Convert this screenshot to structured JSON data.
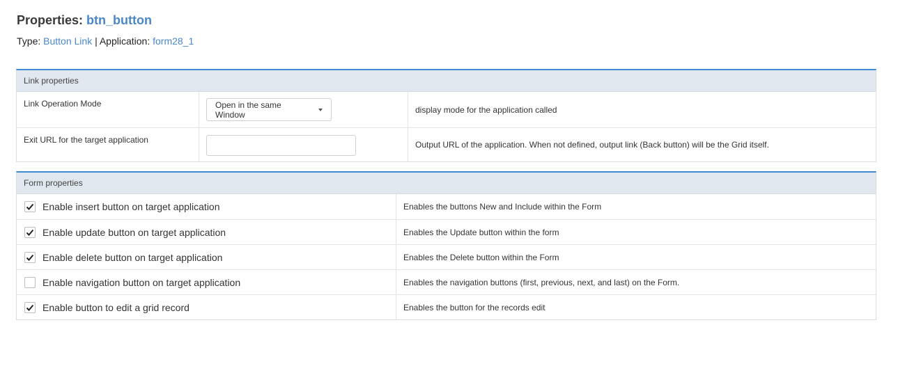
{
  "header": {
    "title_prefix": "Properties: ",
    "title_name": "btn_button",
    "type_label": "Type: ",
    "type_value": "Button Link",
    "separator": " | Application: ",
    "application_value": "form28_1"
  },
  "link_section": {
    "title": "Link properties",
    "rows": [
      {
        "label": "Link Operation Mode",
        "select_value": "Open in the same Window",
        "description": "display mode for the application called"
      },
      {
        "label": "Exit URL for the target application",
        "input_value": "",
        "description": "Output URL of the application. When not defined, output link (Back button) will be the Grid itself."
      }
    ]
  },
  "form_section": {
    "title": "Form properties",
    "rows": [
      {
        "label": "Enable insert button on target application",
        "checked": true,
        "description": "Enables the buttons New and Include within the Form"
      },
      {
        "label": "Enable update button on target application",
        "checked": true,
        "description": "Enables the Update button within the form"
      },
      {
        "label": "Enable delete button on target application",
        "checked": true,
        "description": "Enables the Delete button within the Form"
      },
      {
        "label": "Enable navigation button on target application",
        "checked": false,
        "description": "Enables the navigation buttons (first, previous, next, and last) on the Form."
      },
      {
        "label": "Enable button to edit a grid record",
        "checked": true,
        "description": "Enables the button for the records edit"
      }
    ]
  },
  "colors": {
    "accent": "#4a87c8",
    "section_border": "#3d8bd3",
    "section_head_bg": "#e1e7ef"
  }
}
